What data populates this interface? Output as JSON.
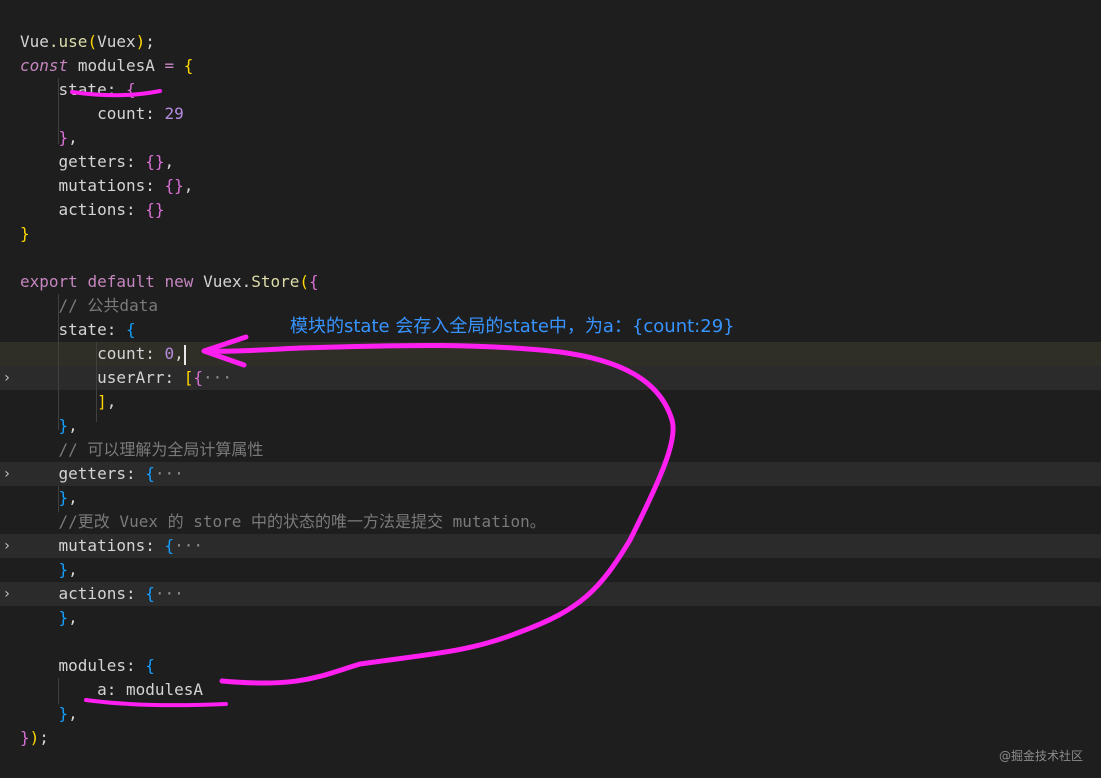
{
  "code_lines": [
    {
      "parts": [
        [
          "var",
          "Vue"
        ],
        [
          "fn",
          ".use"
        ],
        [
          "brace1",
          "("
        ],
        [
          "var",
          "Vuex"
        ],
        [
          "brace1",
          ")"
        ],
        [
          "punc",
          ";"
        ]
      ]
    },
    {
      "parts": [
        [
          "kw",
          "const"
        ],
        [
          "punc",
          " "
        ],
        [
          "var",
          "modulesA"
        ],
        [
          "punc",
          " "
        ],
        [
          "kw2",
          "="
        ],
        [
          "punc",
          " "
        ],
        [
          "brace1",
          "{"
        ]
      ]
    },
    {
      "parts": [
        [
          "punc",
          "    "
        ],
        [
          "prop",
          "state"
        ],
        [
          "punc",
          ": "
        ],
        [
          "brace2",
          "{"
        ]
      ]
    },
    {
      "parts": [
        [
          "punc",
          "        "
        ],
        [
          "prop",
          "count"
        ],
        [
          "punc",
          ": "
        ],
        [
          "num2",
          "29"
        ]
      ]
    },
    {
      "parts": [
        [
          "punc",
          "    "
        ],
        [
          "brace2",
          "}"
        ],
        [
          "punc",
          ","
        ]
      ]
    },
    {
      "parts": [
        [
          "punc",
          "    "
        ],
        [
          "prop",
          "getters"
        ],
        [
          "punc",
          ": "
        ],
        [
          "brace2",
          "{}"
        ],
        [
          "punc",
          ","
        ]
      ]
    },
    {
      "parts": [
        [
          "punc",
          "    "
        ],
        [
          "prop",
          "mutations"
        ],
        [
          "punc",
          ": "
        ],
        [
          "brace2",
          "{}"
        ],
        [
          "punc",
          ","
        ]
      ]
    },
    {
      "parts": [
        [
          "punc",
          "    "
        ],
        [
          "prop",
          "actions"
        ],
        [
          "punc",
          ": "
        ],
        [
          "brace2",
          "{}"
        ]
      ]
    },
    {
      "parts": [
        [
          "brace1",
          "}"
        ]
      ]
    },
    {
      "parts": []
    },
    {
      "parts": [
        [
          "kw2",
          "export"
        ],
        [
          "punc",
          " "
        ],
        [
          "kw2",
          "default"
        ],
        [
          "punc",
          " "
        ],
        [
          "kw2",
          "new"
        ],
        [
          "punc",
          " "
        ],
        [
          "var",
          "Vuex"
        ],
        [
          "punc",
          "."
        ],
        [
          "fn",
          "Store"
        ],
        [
          "brace1",
          "("
        ],
        [
          "brace2",
          "{"
        ]
      ]
    },
    {
      "parts": [
        [
          "punc",
          "    "
        ],
        [
          "comment",
          "// 公共data"
        ]
      ]
    },
    {
      "parts": [
        [
          "punc",
          "    "
        ],
        [
          "prop",
          "state"
        ],
        [
          "punc",
          ": "
        ],
        [
          "brace3",
          "{"
        ]
      ]
    },
    {
      "parts": [
        [
          "punc",
          "        "
        ],
        [
          "prop",
          "count"
        ],
        [
          "punc",
          ": "
        ],
        [
          "num2",
          "0"
        ],
        [
          "punc",
          ","
        ]
      ],
      "cursor": true
    },
    {
      "parts": [
        [
          "punc",
          "        "
        ],
        [
          "prop",
          "userArr"
        ],
        [
          "punc",
          ": "
        ],
        [
          "brace1",
          "["
        ],
        [
          "brace2",
          "{"
        ],
        [
          "ell",
          "···"
        ]
      ],
      "fold": true
    },
    {
      "parts": [
        [
          "punc",
          "        "
        ],
        [
          "brace1",
          "]"
        ],
        [
          "punc",
          ","
        ]
      ]
    },
    {
      "parts": [
        [
          "punc",
          "    "
        ],
        [
          "brace3",
          "}"
        ],
        [
          "punc",
          ","
        ]
      ]
    },
    {
      "parts": [
        [
          "punc",
          "    "
        ],
        [
          "comment",
          "// 可以理解为全局计算属性"
        ]
      ]
    },
    {
      "parts": [
        [
          "punc",
          "    "
        ],
        [
          "prop",
          "getters"
        ],
        [
          "punc",
          ": "
        ],
        [
          "brace3",
          "{"
        ],
        [
          "ell",
          "···"
        ]
      ],
      "fold": true
    },
    {
      "parts": [
        [
          "punc",
          "    "
        ],
        [
          "brace3",
          "}"
        ],
        [
          "punc",
          ","
        ]
      ]
    },
    {
      "parts": [
        [
          "punc",
          "    "
        ],
        [
          "comment",
          "//更改 Vuex 的 store 中的状态的唯一方法是提交 mutation。"
        ]
      ]
    },
    {
      "parts": [
        [
          "punc",
          "    "
        ],
        [
          "prop",
          "mutations"
        ],
        [
          "punc",
          ": "
        ],
        [
          "brace3",
          "{"
        ],
        [
          "ell",
          "···"
        ]
      ],
      "fold": true
    },
    {
      "parts": [
        [
          "punc",
          "    "
        ],
        [
          "brace3",
          "}"
        ],
        [
          "punc",
          ","
        ]
      ]
    },
    {
      "parts": [
        [
          "punc",
          "    "
        ],
        [
          "prop",
          "actions"
        ],
        [
          "punc",
          ": "
        ],
        [
          "brace3",
          "{"
        ],
        [
          "ell",
          "···"
        ]
      ],
      "fold": true
    },
    {
      "parts": [
        [
          "punc",
          "    "
        ],
        [
          "brace3",
          "}"
        ],
        [
          "punc",
          ","
        ]
      ]
    },
    {
      "parts": []
    },
    {
      "parts": [
        [
          "punc",
          "    "
        ],
        [
          "prop",
          "modules"
        ],
        [
          "punc",
          ": "
        ],
        [
          "brace3",
          "{"
        ]
      ]
    },
    {
      "parts": [
        [
          "punc",
          "        "
        ],
        [
          "prop",
          "a"
        ],
        [
          "punc",
          ": "
        ],
        [
          "var",
          "modulesA"
        ]
      ]
    },
    {
      "parts": [
        [
          "punc",
          "    "
        ],
        [
          "brace3",
          "}"
        ],
        [
          "punc",
          ","
        ]
      ]
    },
    {
      "parts": [
        [
          "brace2",
          "}"
        ],
        [
          "brace1",
          ")"
        ],
        [
          "punc",
          ";"
        ]
      ]
    }
  ],
  "annotation": "模块的state 会存入全局的state中，为a：{count:29}",
  "watermark": "@掘金技术社区",
  "colors": {
    "background": "#1e1e1e",
    "annotation_ink": "#ff1ff0",
    "annotation_text": "#3794ff"
  },
  "fold_icon": "chevron-right-icon"
}
